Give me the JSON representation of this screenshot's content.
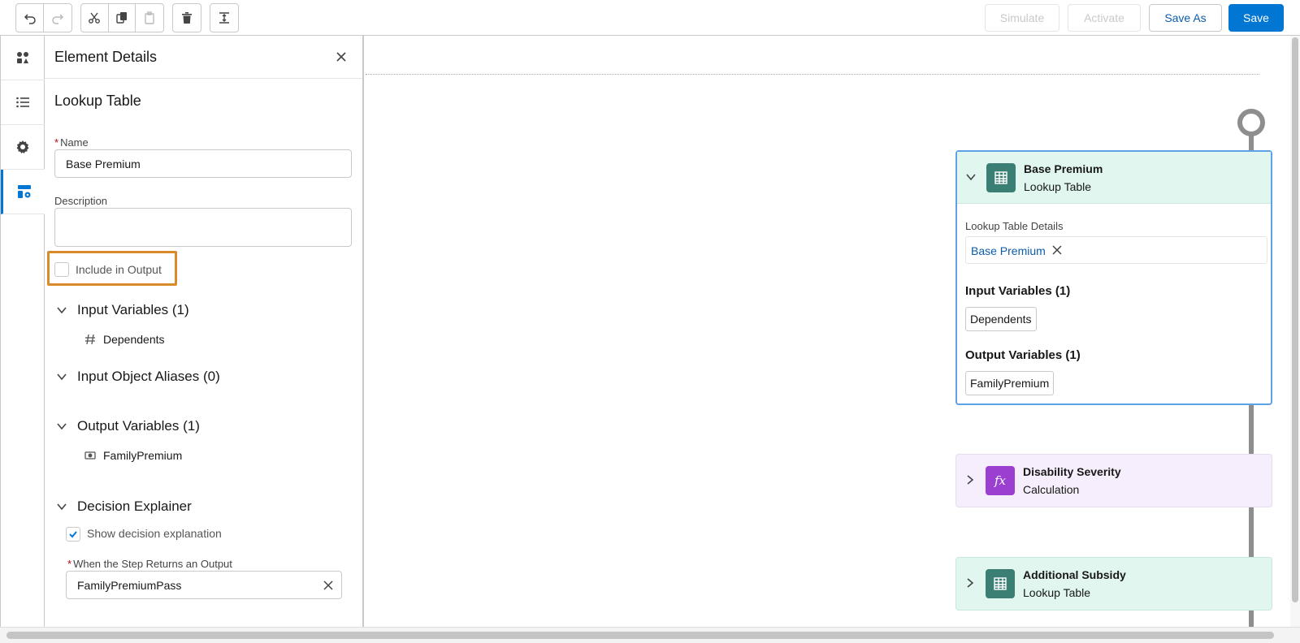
{
  "toolbar": {
    "simulate_label": "Simulate",
    "activate_label": "Activate",
    "save_as_label": "Save As",
    "save_label": "Save"
  },
  "rail": {
    "items": [
      {
        "icon": "components-icon"
      },
      {
        "icon": "list-icon"
      },
      {
        "icon": "settings-icon"
      },
      {
        "icon": "element-details-icon",
        "active": true
      }
    ]
  },
  "panel": {
    "title": "Element Details",
    "element_type": "Lookup Table",
    "name_label": "Name",
    "name_value": "Base Premium",
    "description_label": "Description",
    "description_value": "",
    "include_output_label": "Include in Output",
    "include_output_checked": false,
    "input_variables_header": "Input Variables (1)",
    "input_variable": "Dependents",
    "input_aliases_header": "Input Object Aliases (0)",
    "output_variables_header": "Output Variables (1)",
    "output_variable": "FamilyPremium",
    "decision_explainer_header": "Decision Explainer",
    "show_explanation_label": "Show decision explanation",
    "show_explanation_checked": true,
    "when_output_label": "When the Step Returns an Output",
    "when_output_value": "FamilyPremiumPass"
  },
  "canvas": {
    "node1": {
      "title": "Base Premium",
      "subtitle": "Lookup Table",
      "details_label": "Lookup Table Details",
      "details_pill": "Base Premium",
      "input_header": "Input Variables (1)",
      "input_pill": "Dependents",
      "output_header": "Output Variables (1)",
      "output_pill": "FamilyPremium"
    },
    "node2": {
      "title": "Disability Severity",
      "subtitle": "Calculation"
    },
    "node3": {
      "title": "Additional Subsidy",
      "subtitle": "Lookup Table"
    }
  },
  "colors": {
    "brand": "#0176d3",
    "highlight": "#d98b2b",
    "lookup_teal": "#3b7e74",
    "calc_purple": "#9b3fd1"
  }
}
